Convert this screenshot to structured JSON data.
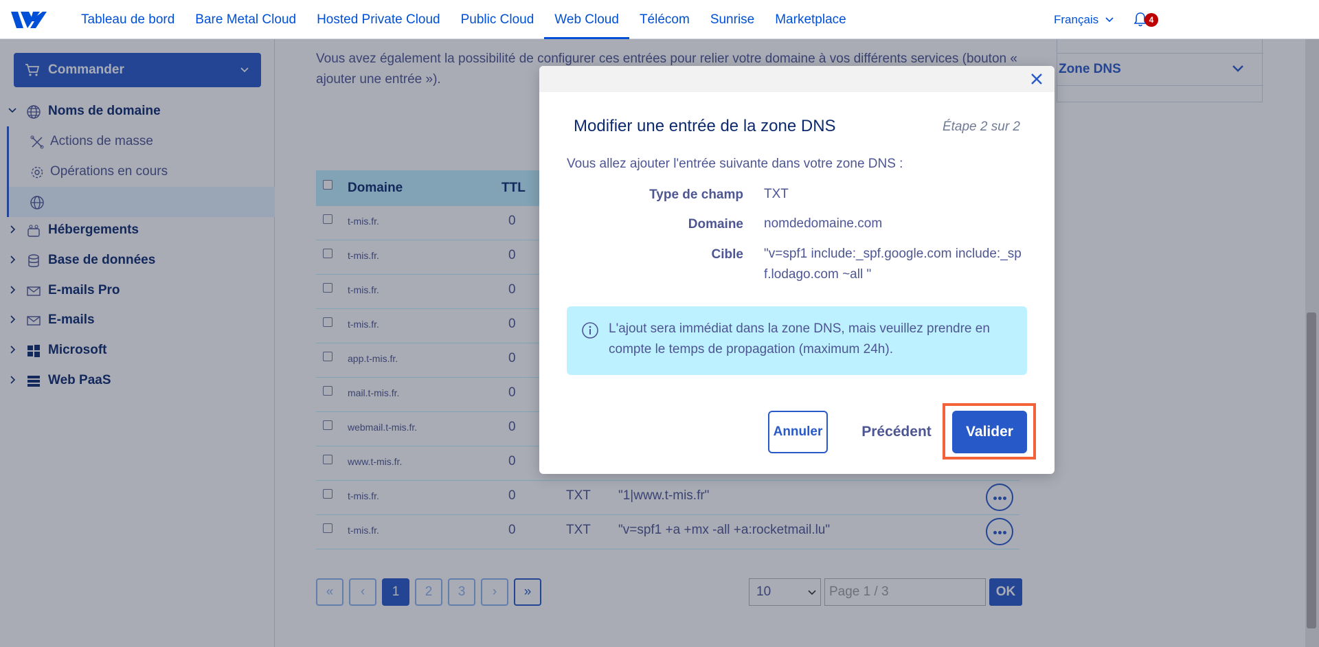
{
  "nav": {
    "items": [
      "Tableau de bord",
      "Bare Metal Cloud",
      "Hosted Private Cloud",
      "Public Cloud",
      "Web Cloud",
      "Télécom",
      "Sunrise",
      "Marketplace"
    ],
    "active": "Web Cloud",
    "language": "Français",
    "notifications": "4"
  },
  "sidebar": {
    "order_label": "Commander",
    "domains_label": "Noms de domaine",
    "sub_items": [
      "Actions de masse",
      "Opérations en cours",
      ""
    ],
    "sections": [
      "Hébergements",
      "Base de données",
      "E-mails Pro",
      "E-mails",
      "Microsoft",
      "Web PaaS"
    ]
  },
  "main": {
    "intro": "Vous avez également la possibilité de configurer ces entrées pour relier votre domaine à vos différents services (bouton « ajouter une entrée »).",
    "zone_label": "Zone DNS",
    "table": {
      "headers": [
        "Domaine",
        "TTL"
      ],
      "rows": [
        {
          "domain": "t-mis.fr.",
          "ttl": "0",
          "type": "",
          "target": ""
        },
        {
          "domain": "t-mis.fr.",
          "ttl": "0",
          "type": "",
          "target": ""
        },
        {
          "domain": "t-mis.fr.",
          "ttl": "0",
          "type": "",
          "target": ""
        },
        {
          "domain": "t-mis.fr.",
          "ttl": "0",
          "type": "",
          "target": ""
        },
        {
          "domain": "app.t-mis.fr.",
          "ttl": "0",
          "type": "",
          "target": ""
        },
        {
          "domain": "mail.t-mis.fr.",
          "ttl": "0",
          "type": "",
          "target": ""
        },
        {
          "domain": "webmail.t-mis.fr.",
          "ttl": "0",
          "type": "",
          "target": ""
        },
        {
          "domain": "www.t-mis.fr.",
          "ttl": "0",
          "type": "",
          "target": ""
        },
        {
          "domain": "t-mis.fr.",
          "ttl": "0",
          "type": "TXT",
          "target": "\"1|www.t-mis.fr\""
        },
        {
          "domain": "t-mis.fr.",
          "ttl": "0",
          "type": "TXT",
          "target": "\"v=spf1 +a +mx -all +a:rocketmail.lu\""
        }
      ]
    },
    "pager": {
      "first": "«",
      "prev": "‹",
      "pages": [
        "1",
        "2",
        "3"
      ],
      "next": "›",
      "last": "»",
      "page_size": "10",
      "page_placeholder": "Page 1 / 3",
      "ok": "OK"
    }
  },
  "modal": {
    "title": "Modifier une entrée de la zone DNS",
    "step": "Étape 2 sur 2",
    "intro": "Vous allez ajouter l'entrée suivante dans votre zone DNS :",
    "fields": [
      {
        "label": "Type de champ",
        "value": "TXT"
      },
      {
        "label": "Domaine",
        "value": "nomdedomaine.com"
      },
      {
        "label": "Cible",
        "value": "\"v=spf1 include:_spf.google.com include:_spf.lodago.com ~all \""
      }
    ],
    "info": "L'ajout sera immédiat dans la zone DNS, mais veuillez prendre en compte le temps de propagation (maximum 24h).",
    "cancel": "Annuler",
    "previous": "Précédent",
    "confirm": "Valider"
  }
}
